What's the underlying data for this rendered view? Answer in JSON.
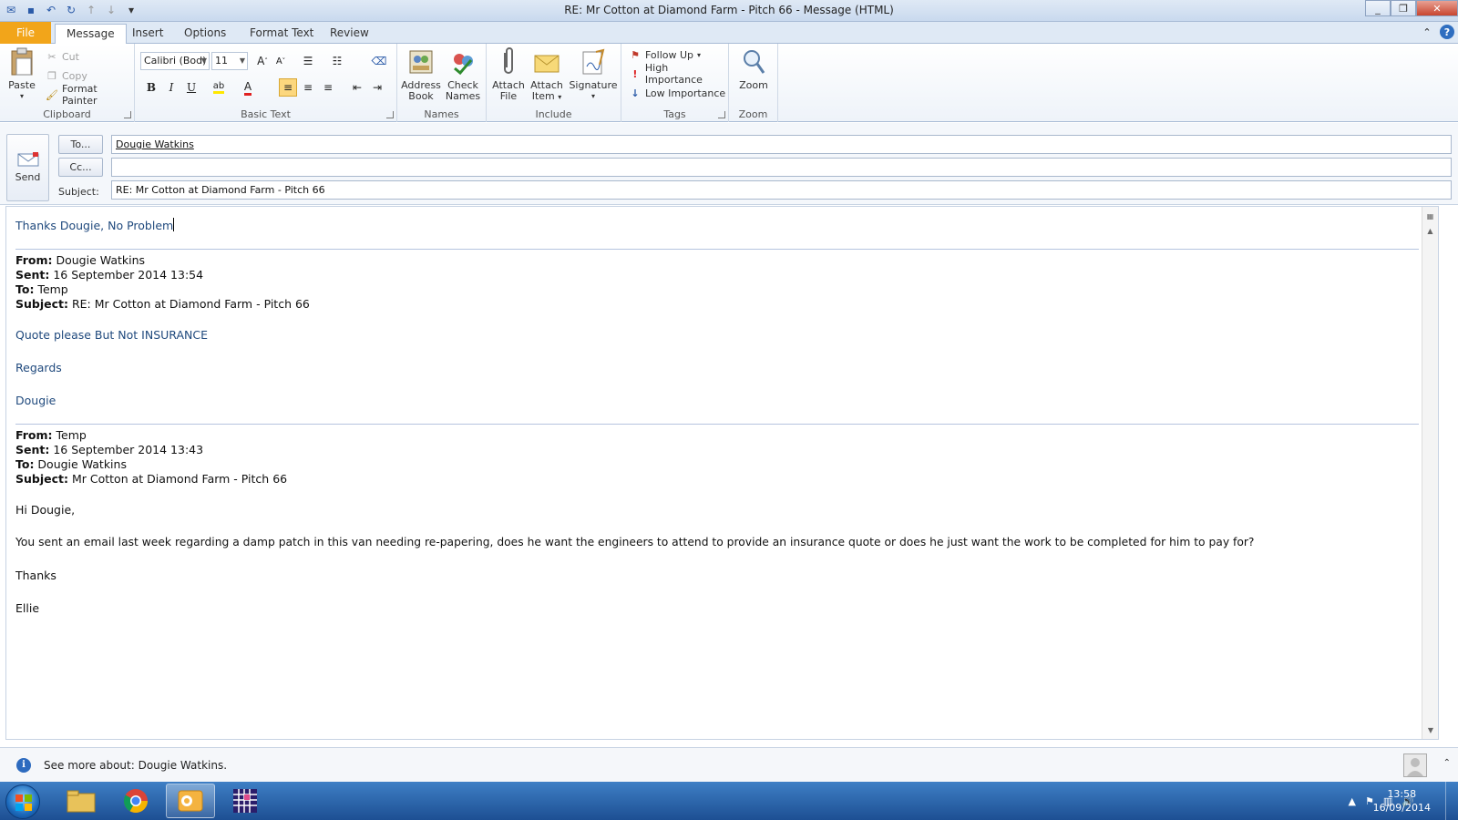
{
  "window": {
    "title": "RE: Mr Cotton at Diamond Farm - Pitch 66  -  Message (HTML)"
  },
  "tabs": {
    "file": "File",
    "items": [
      "Message",
      "Insert",
      "Options",
      "Format Text",
      "Review"
    ],
    "active": "Message"
  },
  "ribbon": {
    "clipboard": {
      "label": "Clipboard",
      "paste": "Paste",
      "cut": "Cut",
      "copy": "Copy",
      "format_painter": "Format Painter"
    },
    "basic_text": {
      "label": "Basic Text",
      "font": "Calibri (Bod)",
      "size": "11"
    },
    "names": {
      "label": "Names",
      "address_book_1": "Address",
      "address_book_2": "Book",
      "check_names_1": "Check",
      "check_names_2": "Names"
    },
    "include": {
      "label": "Include",
      "attach_file_1": "Attach",
      "attach_file_2": "File",
      "attach_item_1": "Attach",
      "attach_item_2": "Item",
      "signature": "Signature"
    },
    "tags": {
      "label": "Tags",
      "follow_up": "Follow Up",
      "high": "High Importance",
      "low": "Low Importance"
    },
    "zoom": {
      "label": "Zoom",
      "zoom": "Zoom"
    }
  },
  "compose": {
    "send": "Send",
    "to_button": "To...",
    "cc_button": "Cc...",
    "subject_label": "Subject:",
    "to_value": "Dougie Watkins",
    "cc_value": "",
    "subject_value": "RE: Mr Cotton at Diamond Farm - Pitch 66"
  },
  "body": {
    "reply": "Thanks Dougie, No Problem",
    "quote1": {
      "from_label": "From:",
      "from": " Dougie Watkins",
      "sent_label": "Sent:",
      "sent": " 16 September 2014 13:54",
      "to_label": "To:",
      "to": " Temp",
      "subject_label": "Subject:",
      "subject": " RE: Mr Cotton at Diamond Farm - Pitch 66",
      "line1": "Quote please But Not INSURANCE",
      "line2": "Regards",
      "line3": "Dougie"
    },
    "quote2": {
      "from_label": "From:",
      "from": " Temp",
      "sent_label": "Sent:",
      "sent": " 16 September 2014 13:43",
      "to_label": "To:",
      "to": " Dougie Watkins",
      "subject_label": "Subject:",
      "subject": " Mr Cotton at Diamond Farm - Pitch 66",
      "greeting": "Hi Dougie,",
      "para": "You sent an email last week regarding a damp patch in this van needing re-papering, does he want the engineers to attend to provide an insurance quote or does he just want the work to be completed for him to pay for?",
      "thanks": "Thanks",
      "sign": "Ellie"
    }
  },
  "people_pane": {
    "text": "See more about: Dougie Watkins."
  },
  "taskbar": {
    "time": "13:58",
    "date": "16/09/2014"
  },
  "colors": {
    "file_tab": "#f2a51a",
    "quote_blue": "#1f497d",
    "taskbar": "#1d4f93"
  }
}
